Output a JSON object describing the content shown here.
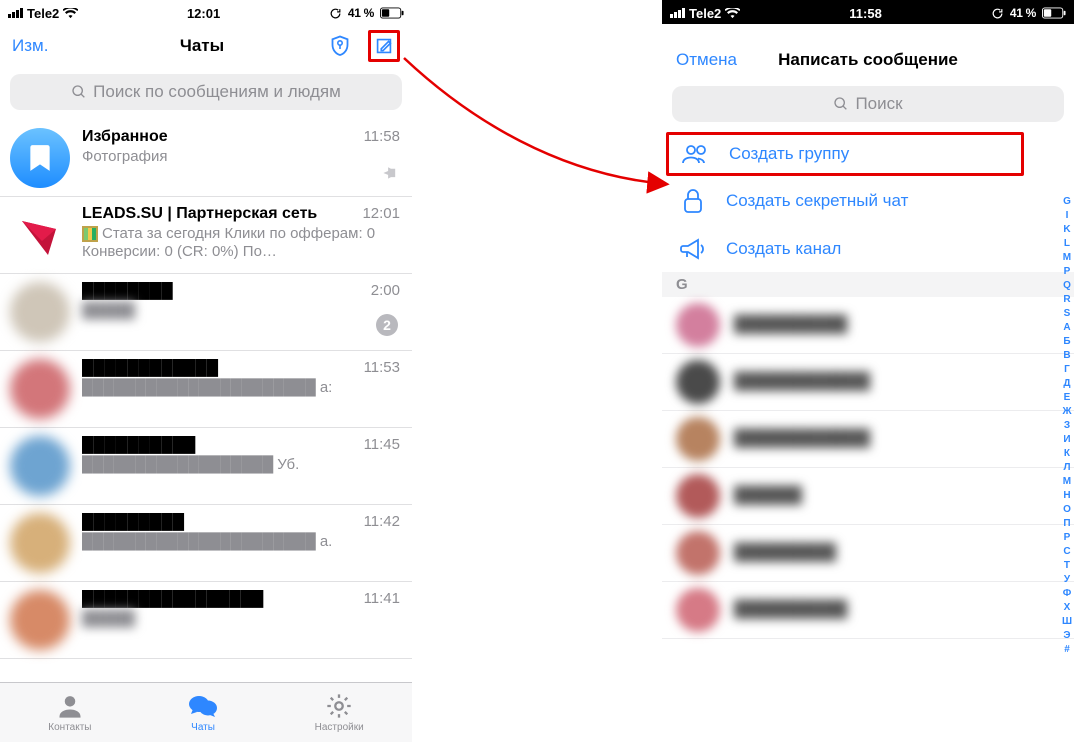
{
  "left": {
    "status": {
      "carrier": "Tele2",
      "time": "12:01",
      "battery": "41 %"
    },
    "nav": {
      "edit": "Изм.",
      "title": "Чаты"
    },
    "search_placeholder": "Поиск по сообщениям и людям",
    "chats": [
      {
        "title": "Избранное",
        "subtitle": "Фотография",
        "time": "11:58",
        "pinned": true
      },
      {
        "title": "LEADS.SU | Партнерская сеть",
        "subtitle": "Стата за сегодня Клики по офферам: 0 Конверсии: 0 (CR: 0%) По…",
        "time": "12:01"
      },
      {
        "title": "",
        "subtitle": "",
        "time": "2:00",
        "badge": "2"
      },
      {
        "title": "",
        "subtitle": "",
        "time": "11:53"
      },
      {
        "title": "",
        "subtitle": "",
        "time": "11:45"
      },
      {
        "title": "",
        "subtitle": "",
        "time": "11:42"
      },
      {
        "title": "",
        "subtitle": "",
        "time": "11:41"
      }
    ],
    "tabs": {
      "contacts": "Контакты",
      "chats": "Чаты",
      "settings": "Настройки"
    }
  },
  "right": {
    "status": {
      "carrier": "Tele2",
      "time": "11:58",
      "battery": "41 %"
    },
    "modal": {
      "cancel": "Отмена",
      "title": "Написать сообщение",
      "search_placeholder": "Поиск",
      "actions": {
        "group": "Создать группу",
        "secret": "Создать секретный чат",
        "channel": "Создать канал"
      },
      "section": "G",
      "index": [
        "G",
        "I",
        "K",
        "L",
        "M",
        "P",
        "Q",
        "R",
        "S",
        "А",
        "Б",
        "В",
        "Г",
        "Д",
        "Е",
        "Ж",
        "З",
        "И",
        "К",
        "Л",
        "М",
        "Н",
        "О",
        "П",
        "Р",
        "С",
        "Т",
        "У",
        "Ф",
        "Х",
        "Ш",
        "Э",
        "#"
      ]
    }
  },
  "blurred_trail": {
    "a": "а:",
    "b": "Уб.",
    "c": "а."
  }
}
